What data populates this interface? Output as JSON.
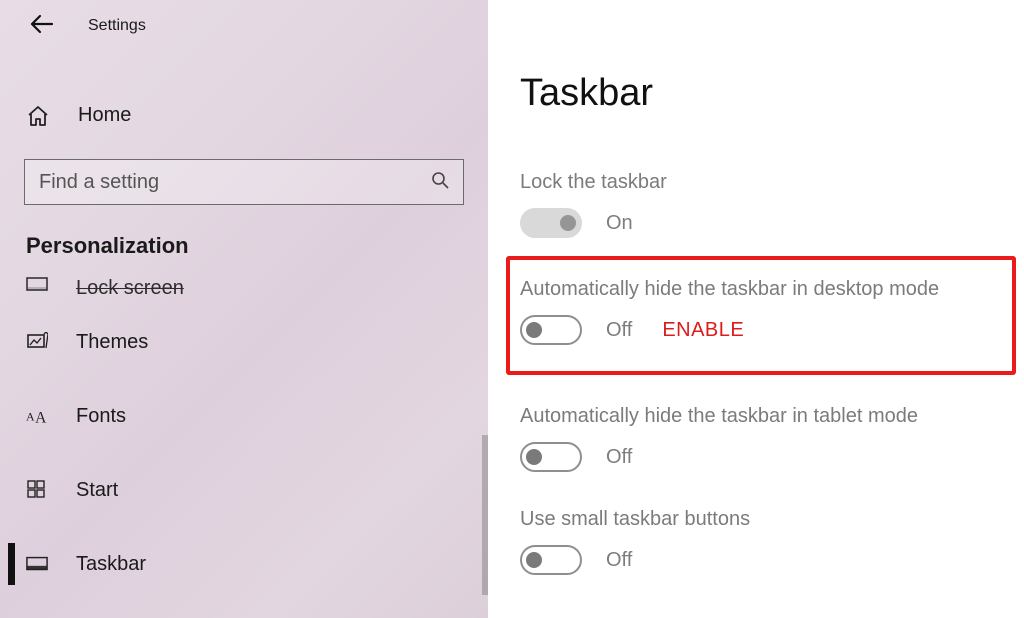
{
  "header": {
    "title": "Settings"
  },
  "sidebar": {
    "home_label": "Home",
    "search_placeholder": "Find a setting",
    "section_label": "Personalization",
    "items": [
      {
        "label": "Lock screen"
      },
      {
        "label": "Themes"
      },
      {
        "label": "Fonts"
      },
      {
        "label": "Start"
      },
      {
        "label": "Taskbar"
      }
    ]
  },
  "main": {
    "title": "Taskbar",
    "settings": [
      {
        "label": "Lock the taskbar",
        "state": "On",
        "on": true,
        "disabled": true
      },
      {
        "label": "Automatically hide the taskbar in desktop mode",
        "state": "Off",
        "on": false,
        "annotation": "ENABLE"
      },
      {
        "label": "Automatically hide the taskbar in tablet mode",
        "state": "Off",
        "on": false
      },
      {
        "label": "Use small taskbar buttons",
        "state": "Off",
        "on": false
      }
    ]
  }
}
